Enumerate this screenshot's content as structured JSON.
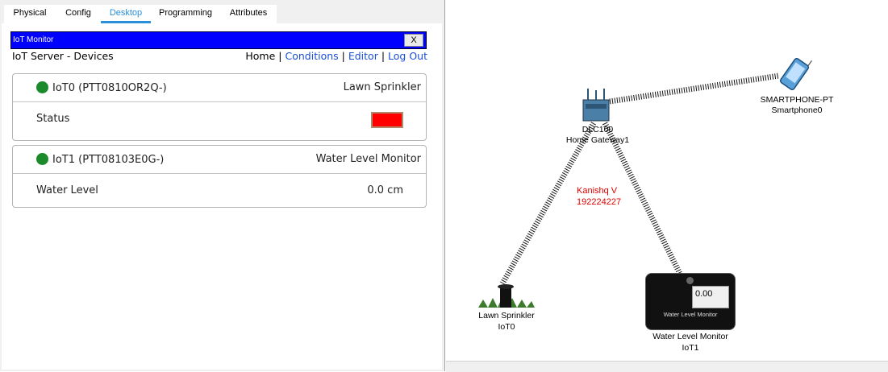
{
  "tabs": [
    {
      "label": "Physical",
      "active": false
    },
    {
      "label": "Config",
      "active": false
    },
    {
      "label": "Desktop",
      "active": true
    },
    {
      "label": "Programming",
      "active": false
    },
    {
      "label": "Attributes",
      "active": false
    }
  ],
  "window": {
    "title": "IoT Monitor",
    "close_label": "X"
  },
  "header": {
    "title": "IoT Server - Devices",
    "nav": {
      "home": "Home",
      "conditions": "Conditions",
      "editor": "Editor",
      "logout": "Log Out",
      "separator": "|"
    }
  },
  "devices": [
    {
      "name": "IoT0 (PTT0810OR2Q-)",
      "type": "Lawn Sprinkler",
      "row_label": "Status",
      "row_value": "",
      "status_color": "#ff0000",
      "online_color": "#1a8a2a"
    },
    {
      "name": "IoT1 (PTT08103E0G-)",
      "type": "Water Level Monitor",
      "row_label": "Water Level",
      "row_value": "0.0 cm",
      "online_color": "#1a8a2a"
    }
  ],
  "topology": {
    "gateway": {
      "model": "DLC100",
      "name": "Home Gateway1"
    },
    "smartphone": {
      "model": "SMARTPHONE-PT",
      "name": "Smartphone0"
    },
    "annotation": {
      "line1": "Kanishq V",
      "line2": "192224227",
      "color": "#e00000"
    },
    "sprinkler": {
      "model": "Lawn Sprinkler",
      "name": "IoT0"
    },
    "water_monitor": {
      "model": "Water Level Monitor",
      "name": "IoT1",
      "reading": "0.00",
      "panel_label": "Water Level Monitor"
    }
  },
  "colors": {
    "accent": "#2a8ed8",
    "titlebar": "#0000ff",
    "link": "#1a4fd6"
  }
}
